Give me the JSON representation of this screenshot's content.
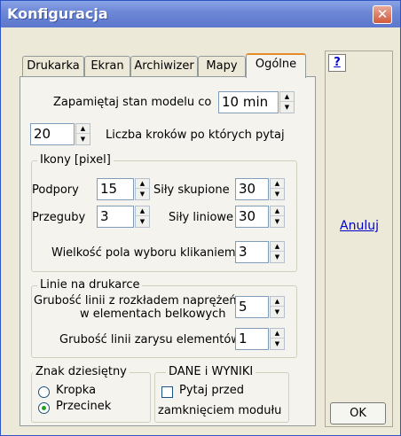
{
  "window": {
    "title": "Konfiguracja",
    "close_glyph": "✕"
  },
  "tabs": [
    {
      "label": "Drukarka"
    },
    {
      "label": "Ekran"
    },
    {
      "label": "Archiwizer"
    },
    {
      "label": "Mapy"
    },
    {
      "label": "Ogólne",
      "active": true
    }
  ],
  "general": {
    "save_label": "Zapamiętaj stan modelu co",
    "save_value": "10 min",
    "steps_value": "20",
    "steps_label": "Liczba kroków po których pytaj"
  },
  "icons_group": {
    "legend": "Ikony [pixel]",
    "supports_label": "Podpory",
    "supports_value": "15",
    "conc_label": "Siły skupione",
    "conc_value": "30",
    "hinges_label": "Przeguby",
    "hinges_value": "3",
    "linear_label": "Siły liniowe",
    "linear_value": "30",
    "pick_label": "Wielkość pola wyboru klikaniem",
    "pick_value": "3"
  },
  "print_group": {
    "legend": "Linie na drukarce",
    "stress_label_1": "Grubość linii z rozkładem naprężeń",
    "stress_label_2": "w elementach belkowych",
    "stress_value": "5",
    "outline_label": "Grubość linii zarysu elementów",
    "outline_value": "1"
  },
  "decimal_group": {
    "legend": "Znak dziesiętny",
    "options": [
      {
        "label": "Kropka",
        "selected": false
      },
      {
        "label": "Przecinek",
        "selected": true
      }
    ]
  },
  "data_group": {
    "legend": "DANE i WYNIKI",
    "checkbox_label": "Pytaj przed",
    "checkbox_checked": false,
    "checkbox_label_2": "zamknięciem modułu"
  },
  "side": {
    "help_label": "?",
    "cancel_label": "Anuluj",
    "ok_label": "OK"
  },
  "colors": {
    "titlebar": "#6e88d6",
    "close_button": "#d05a3c",
    "active_tab_accent": "#e68b2c",
    "link": "#0000cc"
  }
}
